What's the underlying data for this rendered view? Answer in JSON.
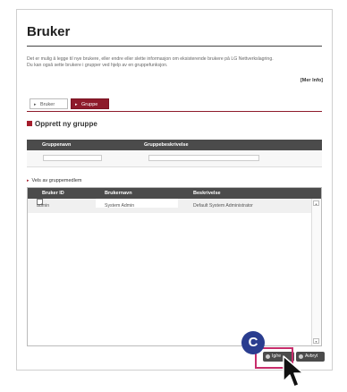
{
  "page": {
    "title": "Bruker",
    "description_lines": [
      "Det er mulig å legge til nye brukere, eller endre eller slette informasjon om eksisterende brukere på LG Nettverkslagring.",
      "Du kan også sette brukere i grupper ved hjelp av en gruppefunksjon."
    ],
    "more_link": "[Mer Info]"
  },
  "tabs": [
    {
      "label": "Bruker"
    },
    {
      "label": "Gruppe"
    }
  ],
  "create_section": {
    "title": "Opprett ny gruppe",
    "headers": {
      "group_name": "Gruppenavn",
      "group_desc": "Gruppebeskrivelse"
    }
  },
  "members_section": {
    "title": "Vels av gruppemedlem",
    "headers": {
      "user_id": "Bruker ID",
      "username": "Brukernavn",
      "description": "Beskrivelse"
    },
    "rows": [
      {
        "user_id": "admin",
        "username": "System Admin",
        "description": "Default System Administrator"
      }
    ]
  },
  "buttons": {
    "apply": "Ig/re",
    "cancel": "Avbryt"
  },
  "callout": {
    "label": "C",
    "color": "#2a3d8f",
    "highlight_color": "#c72d6b"
  },
  "icons": [
    "section-square-icon",
    "tab-arrow-icon",
    "checkbox",
    "scroll-up-icon",
    "scroll-down-icon",
    "mouse-cursor-icon"
  ]
}
